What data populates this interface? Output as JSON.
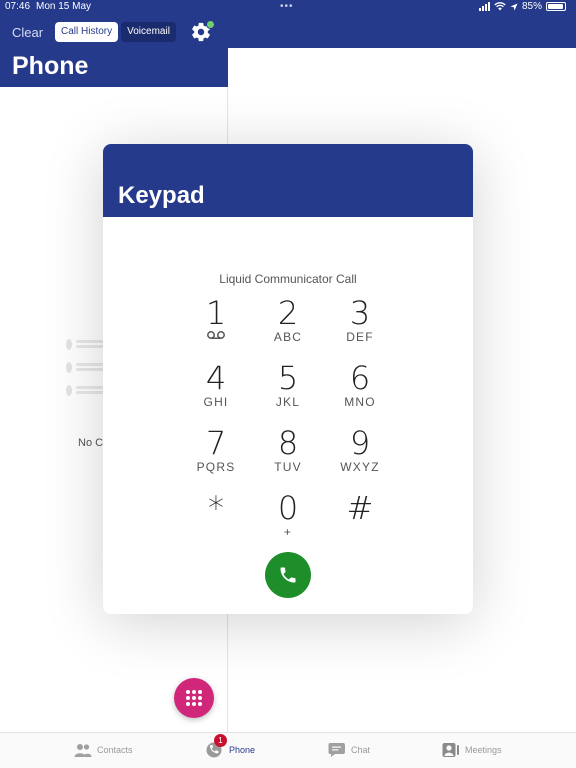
{
  "status_bar": {
    "time": "07:46",
    "date": "Mon 15 May",
    "dots": "•••",
    "battery": "85%"
  },
  "header": {
    "clear_label": "Clear",
    "segments": [
      "Call History",
      "Voicemail"
    ],
    "title": "Phone"
  },
  "empty_state": {
    "text": "No Ca"
  },
  "keypad": {
    "title": "Keypad",
    "call_label": "Liquid Communicator Call",
    "keys": [
      {
        "digit": "1",
        "sub": ""
      },
      {
        "digit": "2",
        "sub": "ABC"
      },
      {
        "digit": "3",
        "sub": "DEF"
      },
      {
        "digit": "4",
        "sub": "GHI"
      },
      {
        "digit": "5",
        "sub": "JKL"
      },
      {
        "digit": "6",
        "sub": "MNO"
      },
      {
        "digit": "7",
        "sub": "PQRS"
      },
      {
        "digit": "8",
        "sub": "TUV"
      },
      {
        "digit": "9",
        "sub": "WXYZ"
      },
      {
        "digit": "*",
        "sub": ""
      },
      {
        "digit": "0",
        "sub": "+"
      },
      {
        "digit": "#",
        "sub": ""
      }
    ]
  },
  "tabs": {
    "contacts": "Contacts",
    "phone": "Phone",
    "chat": "Chat",
    "meetings": "Meetings",
    "phone_badge": "1"
  },
  "colors": {
    "brand_navy": "#263a8c",
    "call_green": "#1e8e2a",
    "fab_magenta": "#d0277b",
    "badge_red": "#c8102e",
    "status_dot_green": "#6fd06a"
  }
}
